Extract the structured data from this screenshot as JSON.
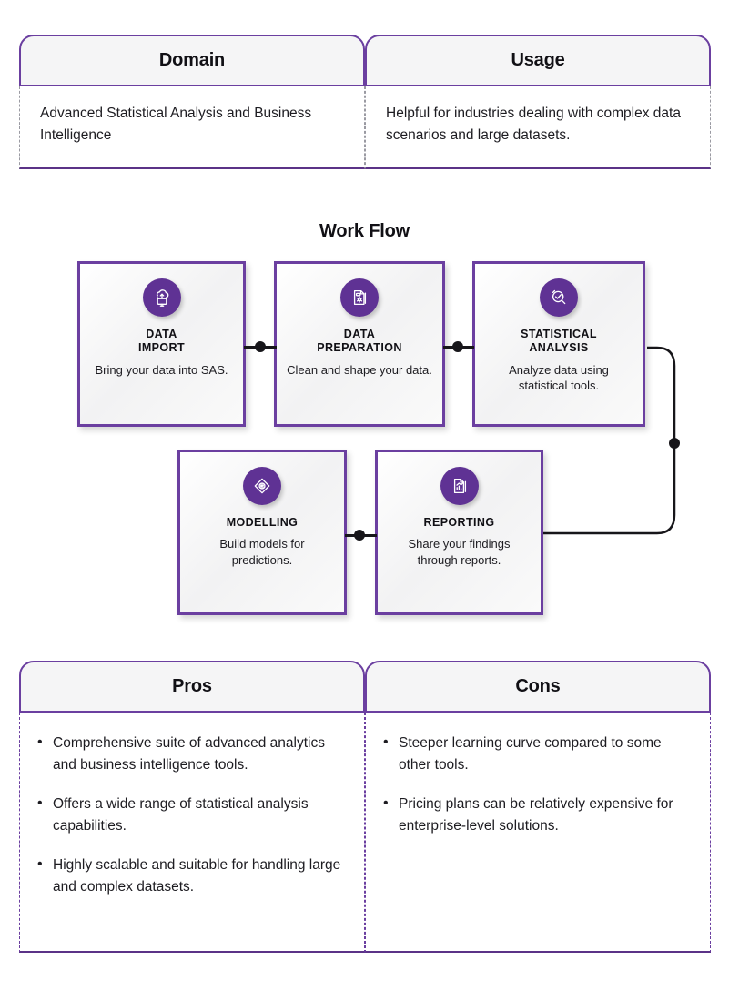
{
  "top_table": {
    "columns": [
      {
        "header": "Domain",
        "body": "Advanced Statistical Analysis and Business Intelligence"
      },
      {
        "header": "Usage",
        "body": "Helpful for industries dealing with complex data scenarios and large datasets."
      }
    ]
  },
  "workflow": {
    "title": "Work Flow",
    "steps": [
      {
        "icon": "cloud-upload-monitor-icon",
        "title": "DATA IMPORT",
        "title_line1": "DATA",
        "title_line2": "IMPORT",
        "desc": "Bring your data into SAS."
      },
      {
        "icon": "document-settings-icon",
        "title": "DATA PREPARATION",
        "title_line1": "DATA",
        "title_line2": "PREPARATION",
        "desc": "Clean and shape your data."
      },
      {
        "icon": "magnifier-check-icon",
        "title": "STATISTICAL ANALYSIS",
        "title_line1": "STATISTICAL",
        "title_line2": "ANALYSIS",
        "desc": "Analyze data using statistical tools."
      },
      {
        "icon": "diamond-node-icon",
        "title": "MODELLING",
        "title_line1": "MODELLING",
        "title_line2": "",
        "desc": "Build models for predictions."
      },
      {
        "icon": "report-chart-icon",
        "title": "REPORTING",
        "title_line1": "REPORTING",
        "title_line2": "",
        "desc": "Share your findings through reports."
      }
    ]
  },
  "bottom_table": {
    "columns": [
      {
        "header": "Pros",
        "items": [
          "Comprehensive suite of advanced analytics and business intelligence tools.",
          "Offers a wide range of statistical analysis capabilities.",
          "Highly scalable and suitable for handling large and complex datasets."
        ]
      },
      {
        "header": "Cons",
        "items": [
          "Steeper learning curve compared to some other tools.",
          "Pricing plans can be relatively expensive for enterprise-level solutions."
        ]
      }
    ]
  },
  "colors": {
    "accent_purple": "#6b3fa0",
    "icon_purple": "#5f3294",
    "header_fill": "#f5f5f6",
    "line_black": "#17161a",
    "text": "#1d1c21"
  }
}
